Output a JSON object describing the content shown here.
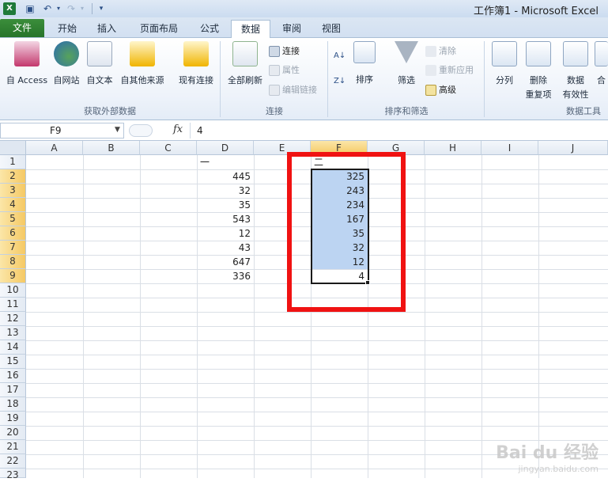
{
  "title_bar": {
    "window_title": "工作簿1 - Microsoft Excel",
    "app_icon": "X",
    "icons": [
      "excel-icon",
      "save-icon",
      "undo-icon",
      "redo-icon",
      "customize-quick-access-icon"
    ]
  },
  "ribbon_tabs": [
    "文件",
    "开始",
    "插入",
    "页面布局",
    "公式",
    "数据",
    "审阅",
    "视图"
  ],
  "active_tab": "数据",
  "ribbon": {
    "get_external_data": {
      "label": "获取外部数据",
      "buttons": [
        "自 Access",
        "自网站",
        "自文本",
        "自其他来源",
        "现有连接"
      ]
    },
    "connections": {
      "label": "连接",
      "refresh_all": "全部刷新",
      "connections": "连接",
      "properties": "属性",
      "edit_links": "编辑链接"
    },
    "sort_filter": {
      "label": "排序和筛选",
      "sort": "排序",
      "filter": "筛选",
      "clear": "清除",
      "reapply": "重新应用",
      "advanced": "高级"
    },
    "data_tools": {
      "label": "数据工具",
      "text_to_columns": "分列",
      "remove_duplicates_1": "删除",
      "remove_duplicates_2": "重复项",
      "data_validation_1": "数据",
      "data_validation_2": "有效性",
      "consolidate": "合"
    }
  },
  "formula_bar": {
    "name_box": "F9",
    "fx": "fx",
    "value": "4"
  },
  "columns": [
    "A",
    "B",
    "C",
    "D",
    "E",
    "F",
    "G",
    "H",
    "I",
    "J"
  ],
  "rows": [
    "1",
    "2",
    "3",
    "4",
    "5",
    "6",
    "7",
    "8",
    "9",
    "10",
    "11",
    "12",
    "13",
    "14",
    "15",
    "16",
    "17",
    "18",
    "19",
    "20",
    "21",
    "22",
    "23"
  ],
  "cells": {
    "D1": "一",
    "D": [
      "445",
      "32",
      "35",
      "543",
      "12",
      "43",
      "647",
      "336"
    ],
    "F1": "二",
    "F": [
      "325",
      "243",
      "234",
      "167",
      "35",
      "32",
      "12",
      "4"
    ]
  },
  "colors": {
    "file_tab": "#2e7d32",
    "selection_fill": "#bcd4f2",
    "highlight_box": "#f01212",
    "selected_header": "#f5c964"
  },
  "watermark": {
    "main": "Bai du 经验",
    "sub": "jingyan.baidu.com"
  }
}
